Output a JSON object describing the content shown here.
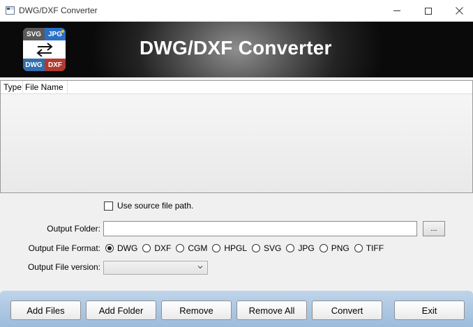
{
  "window": {
    "title": "DWG/DXF Converter",
    "icons": {
      "app": "app-window-icon",
      "minimize": "minimize-icon",
      "maximize": "maximize-icon",
      "close": "close-icon"
    }
  },
  "banner": {
    "title": "DWG/DXF Converter",
    "logo": {
      "tl": "SVG",
      "tr": "JPG",
      "bl": "DWG",
      "br": "DXF",
      "center_icon": "swap-arrows-icon"
    },
    "colors": {
      "tl": "#595959",
      "tr": "#2a6fc8",
      "bl": "#2f6fb0",
      "br": "#b03a2e"
    }
  },
  "file_list": {
    "columns": [
      "Type",
      "File Name"
    ],
    "rows": []
  },
  "options": {
    "use_source_path_label": "Use source file path.",
    "use_source_path_checked": false,
    "output_folder_label": "Output Folder:",
    "output_folder_value": "",
    "browse_label": "...",
    "output_format_label": "Output File Format:",
    "formats": [
      "DWG",
      "DXF",
      "CGM",
      "HPGL",
      "SVG",
      "JPG",
      "PNG",
      "TIFF"
    ],
    "selected_format": "DWG",
    "output_version_label": "Output File version:",
    "output_version_value": ""
  },
  "buttons": {
    "add_files": "Add Files",
    "add_folder": "Add Folder",
    "remove": "Remove",
    "remove_all": "Remove All",
    "convert": "Convert",
    "exit": "Exit"
  }
}
